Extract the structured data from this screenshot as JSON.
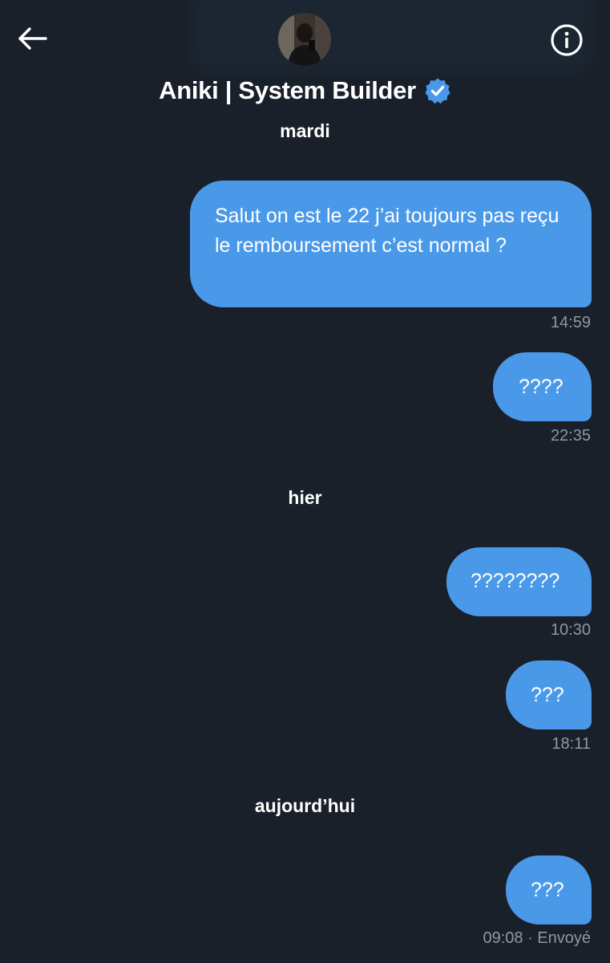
{
  "header": {
    "contact_name": "Aniki | System Builder",
    "back_icon": "arrow-left-icon",
    "info_icon": "info-circle-icon",
    "verified_icon": "verified-badge-icon",
    "colors": {
      "background": "#19202a",
      "bubble": "#4a99e9",
      "verified": "#4a99e9",
      "timestamp": "#8b98a5"
    }
  },
  "conversation": {
    "day_1": "mardi",
    "day_2": "hier",
    "day_3": "aujourd’hui",
    "messages": [
      {
        "text": "Salut on est le 22 j’ai toujours pas reçu le remboursement c’est normal ?",
        "time": "14:59"
      },
      {
        "text": "????",
        "time": "22:35"
      },
      {
        "text": "????????",
        "time": "10:30"
      },
      {
        "text": "???",
        "time": "18:11"
      },
      {
        "text": "???",
        "time": "09:08",
        "status": " · Envoyé"
      }
    ]
  }
}
